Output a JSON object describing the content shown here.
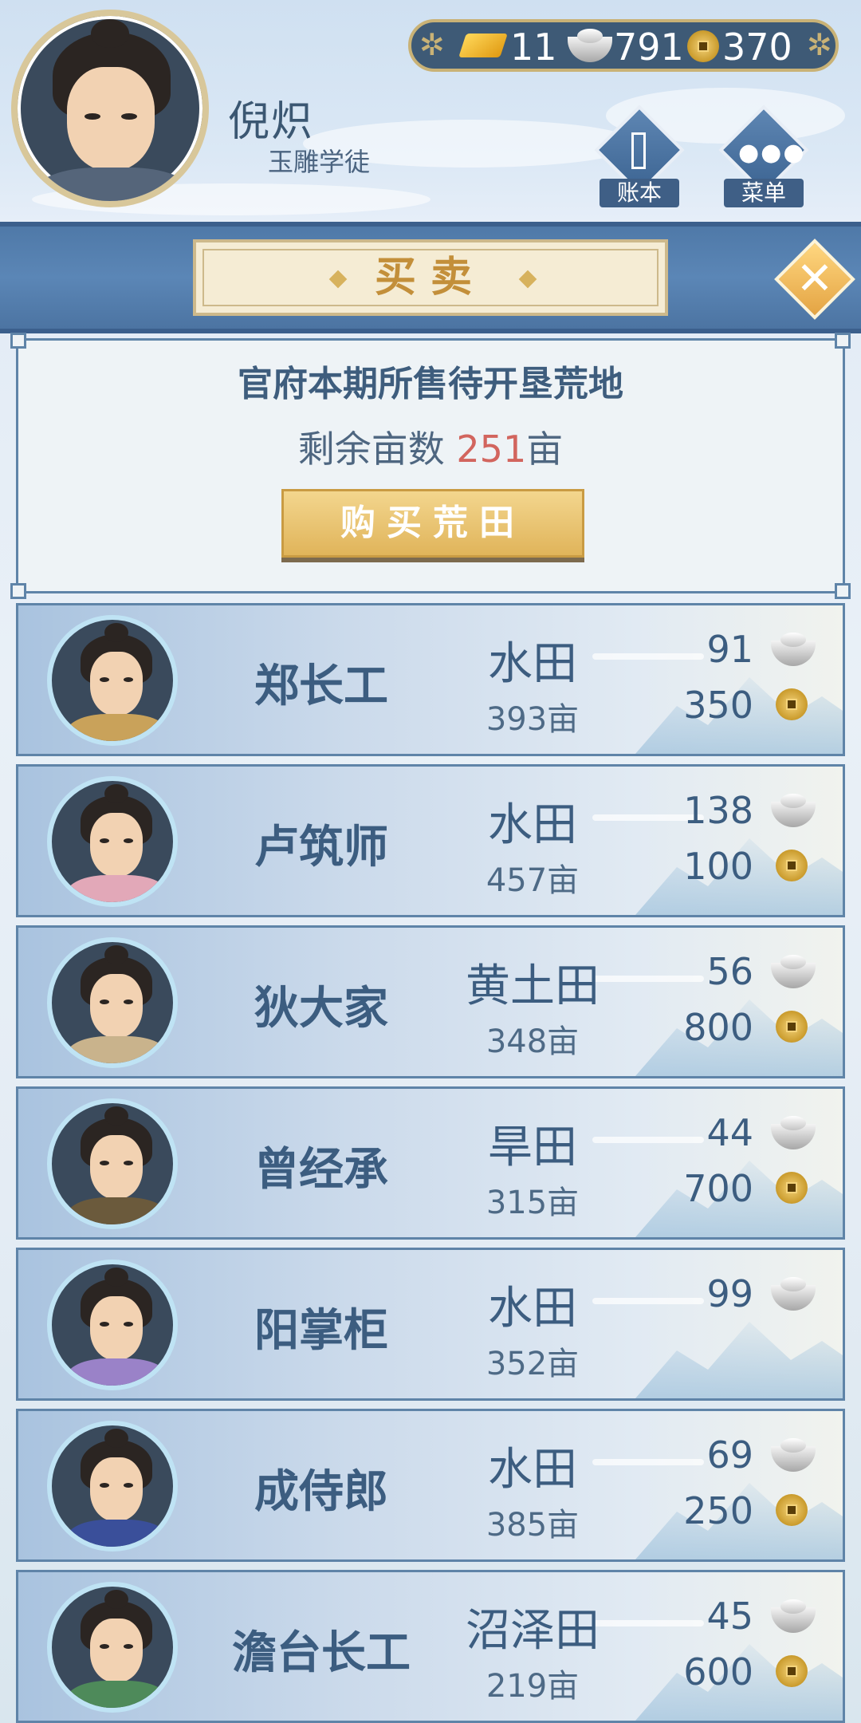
{
  "player": {
    "name": "倪炽",
    "title": "玉雕学徒"
  },
  "currency": {
    "gold": "11",
    "silver": "791",
    "coins": "370"
  },
  "top_buttons": {
    "ledger": "账本",
    "menu": "菜单"
  },
  "banner": {
    "title": "买卖"
  },
  "info": {
    "title": "官府本期所售待开垦荒地",
    "remain_label": "剩余亩数",
    "remain_value": "251",
    "remain_unit": "亩",
    "buy_button": "购买荒田"
  },
  "sellers": [
    {
      "name": "郑长工",
      "land": "水田",
      "area": "393亩",
      "silver": "91",
      "coins": "350",
      "robe": "#c9a25a"
    },
    {
      "name": "卢筑师",
      "land": "水田",
      "area": "457亩",
      "silver": "138",
      "coins": "100",
      "robe": "#e2a8b8"
    },
    {
      "name": "狄大家",
      "land": "黄土田",
      "area": "348亩",
      "silver": "56",
      "coins": "800",
      "robe": "#c9b38c"
    },
    {
      "name": "曾经承",
      "land": "旱田",
      "area": "315亩",
      "silver": "44",
      "coins": "700",
      "robe": "#6b5a3c"
    },
    {
      "name": "阳掌柜",
      "land": "水田",
      "area": "352亩",
      "silver": "99",
      "coins": "",
      "robe": "#9a82c8"
    },
    {
      "name": "成侍郎",
      "land": "水田",
      "area": "385亩",
      "silver": "69",
      "coins": "250",
      "robe": "#3a4f9a"
    },
    {
      "name": "澹台长工",
      "land": "沼泽田",
      "area": "219亩",
      "silver": "45",
      "coins": "600",
      "robe": "#4e8a5a"
    }
  ]
}
